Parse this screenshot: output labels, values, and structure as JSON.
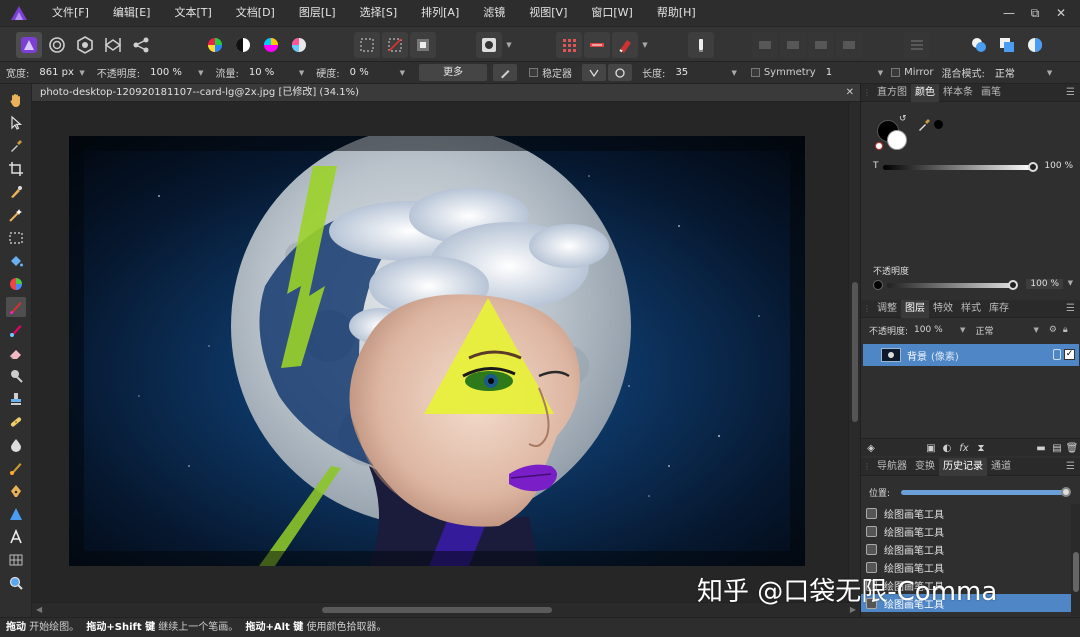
{
  "menu": {
    "items": [
      "文件[F]",
      "编辑[E]",
      "文本[T]",
      "文档[D]",
      "图层[L]",
      "选择[S]",
      "排列[A]",
      "滤镜",
      "视图[V]",
      "窗口[W]",
      "帮助[H]"
    ]
  },
  "window_controls": {
    "minimize": "—",
    "maximize": "⧉",
    "close": "✕"
  },
  "context_bar": {
    "width_label": "宽度:",
    "width_value": "861 px",
    "opacity_label": "不透明度:",
    "opacity_value": "100 %",
    "flow_label": "流量:",
    "flow_value": "10 %",
    "hardness_label": "硬度:",
    "hardness_value": "0 %",
    "more_button": "更多",
    "stabilizer_label": "稳定器",
    "length_label": "长度:",
    "length_value": "35",
    "symmetry_label": "Symmetry",
    "symmetry_value": "1",
    "mirror_label": "Mirror",
    "blend_label": "混合模式:",
    "blend_value": "正常"
  },
  "document": {
    "tab_title": "photo-desktop-120920181107--card-lg@2x.jpg [已修改] (34.1%)",
    "close": "✕"
  },
  "panels": {
    "top_tabs": [
      "直方图",
      "颜色",
      "样本条",
      "画笔"
    ],
    "top_active": "颜色",
    "color": {
      "fill": "#000000",
      "stroke": "#ffffff",
      "t_label": "T",
      "t_value": "100 %",
      "t_level": 1.0,
      "opacity_label": "不透明度",
      "opacity_value": "100 %",
      "opacity_level": 1.0
    },
    "mid_tabs": [
      "调整",
      "图层",
      "特效",
      "样式",
      "库存"
    ],
    "mid_active": "图层",
    "layers": {
      "opacity_label": "不透明度:",
      "opacity_value": "100 %",
      "blend_value": "正常",
      "rows": [
        {
          "name": "背景",
          "extra": "(像素)",
          "visible_check": "✓"
        }
      ]
    },
    "footer_icons": [
      "layers-stack-icon",
      "mask-icon",
      "adjustment-icon",
      "fx-icon",
      "hourglass-icon",
      "folder-icon",
      "new-layer-icon",
      "trash-icon"
    ],
    "bottom_tabs": [
      "导航器",
      "变换",
      "历史记录",
      "通道"
    ],
    "bottom_active": "历史记录",
    "history": {
      "position_label": "位置:",
      "position_level": 1.0,
      "items": [
        "绘图画笔工具",
        "绘图画笔工具",
        "绘图画笔工具",
        "绘图画笔工具",
        "绘图画笔工具",
        "绘图画笔工具"
      ]
    }
  },
  "status": {
    "k1": "拖动",
    "t1": " 开始绘图。",
    "k2": "拖动+Shift 键",
    "t2": " 继续上一个笔画。",
    "k3": "拖动+Alt 键",
    "t3": " 使用颜色拾取器。"
  },
  "watermark": "知乎 @口袋无限-Comma",
  "colors": {
    "accent": "#4f86c6",
    "triangle": "#e8f03a",
    "streak": "#9bd22a",
    "lips": "#7a1ec8",
    "moon": "#c9d0d6",
    "sky": "#0d2a52"
  }
}
